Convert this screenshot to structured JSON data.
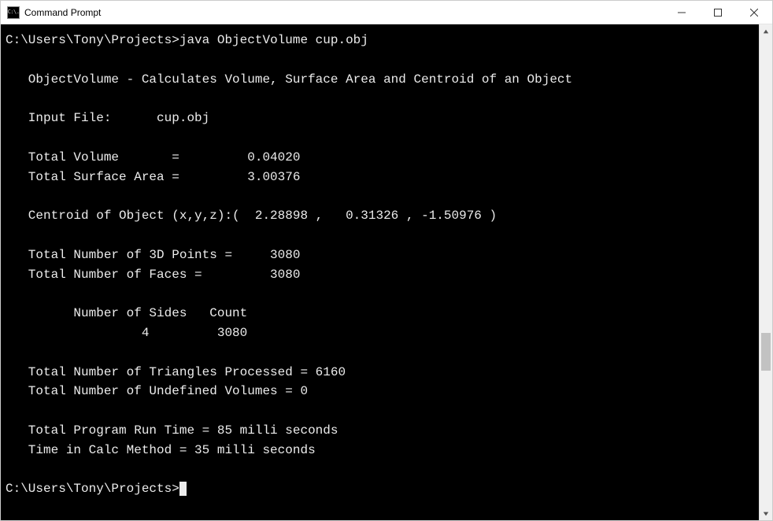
{
  "window": {
    "title": "Command Prompt",
    "icon_text": "C:\\."
  },
  "console": {
    "prompt1": "C:\\Users\\Tony\\Projects>",
    "command": "java ObjectVolume cup.obj",
    "lines": {
      "header": "   ObjectVolume - Calculates Volume, Surface Area and Centroid of an Object",
      "input_file": "   Input File:      cup.obj",
      "volume": "   Total Volume       =         0.04020",
      "surface": "   Total Surface Area =         3.00376",
      "centroid": "   Centroid of Object (x,y,z):(  2.28898 ,   0.31326 , -1.50976 )",
      "points": "   Total Number of 3D Points =     3080",
      "faces": "   Total Number of Faces =         3080",
      "sides_hdr": "         Number of Sides   Count",
      "sides_row": "                  4         3080",
      "triangles": "   Total Number of Triangles Processed = 6160",
      "undefined": "   Total Number of Undefined Volumes = 0",
      "runtime": "   Total Program Run Time = 85 milli seconds",
      "calctime": "   Time in Calc Method = 35 milli seconds"
    },
    "prompt2": "C:\\Users\\Tony\\Projects>"
  }
}
